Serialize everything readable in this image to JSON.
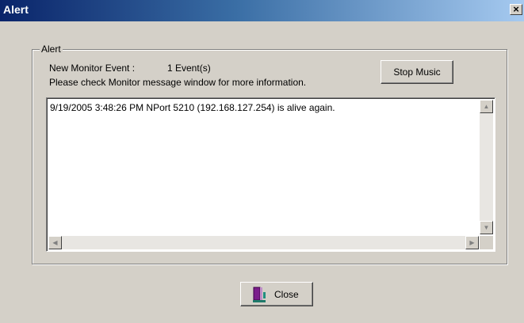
{
  "window": {
    "title": "Alert",
    "close_glyph": "×"
  },
  "group": {
    "label": "Alert"
  },
  "event": {
    "label": "New Monitor Event :",
    "count": "1 Event(s)",
    "info": "Please check Monitor message window for more information."
  },
  "buttons": {
    "stop_music": "Stop Music",
    "close": "Close"
  },
  "messages": [
    "9/19/2005 3:48:26 PM NPort 5210 (192.168.127.254) is alive again."
  ],
  "scroll_glyphs": {
    "up": "▲",
    "down": "▼",
    "left": "◀",
    "right": "▶"
  },
  "icons": {
    "close_button_icon": "door-exit-icon"
  }
}
